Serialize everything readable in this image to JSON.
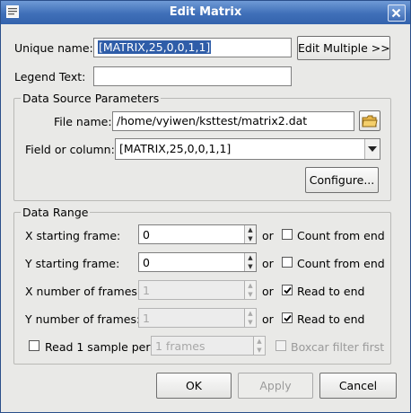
{
  "window": {
    "title": "Edit Matrix",
    "app_icon": "dialog-icon",
    "close_icon": "close-icon"
  },
  "colors": {
    "titlebar": "#3f6fb8",
    "selection": "#2f5da8",
    "window_bg": "#e9e9e7"
  },
  "unique_name": {
    "label": "Unique name:",
    "value": "[MATRIX,25,0,0,1,1]",
    "edit_multiple_label": "Edit Multiple >>"
  },
  "legend_text": {
    "label": "Legend Text:",
    "value": ""
  },
  "data_source": {
    "title": "Data Source Parameters",
    "file_name_label": "File name:",
    "file_name_value": "/home/vyiwen/ksttest/matrix2.dat",
    "file_browse_icon": "folder-icon",
    "field_label": "Field or column:",
    "field_value": "[MATRIX,25,0,0,1,1]",
    "field_dropdown_icon": "chevron-down-icon",
    "configure_label": "Configure..."
  },
  "data_range": {
    "title": "Data Range",
    "x_start_label": "X starting frame:",
    "x_start_value": "0",
    "y_start_label": "Y starting frame:",
    "y_start_value": "0",
    "x_num_label": "X number of frames:",
    "x_num_value": "1",
    "y_num_label": "Y number of frames:",
    "y_num_value": "1",
    "or1": "or",
    "or2": "or",
    "or3": "or",
    "or4": "or",
    "count_from_end_1": "Count from end",
    "count_from_end_2": "Count from end",
    "read_to_end_1": "Read to end",
    "read_to_end_2": "Read to end",
    "read_to_end_1_checked": true,
    "read_to_end_2_checked": true,
    "count_from_end_1_checked": false,
    "count_from_end_2_checked": false,
    "read_sample_label": "Read 1 sample per",
    "read_sample_checked": false,
    "frames_value": "1 frames",
    "boxcar_label": "Boxcar filter first",
    "boxcar_checked": false
  },
  "buttons": {
    "ok": "OK",
    "apply": "Apply",
    "cancel": "Cancel"
  }
}
